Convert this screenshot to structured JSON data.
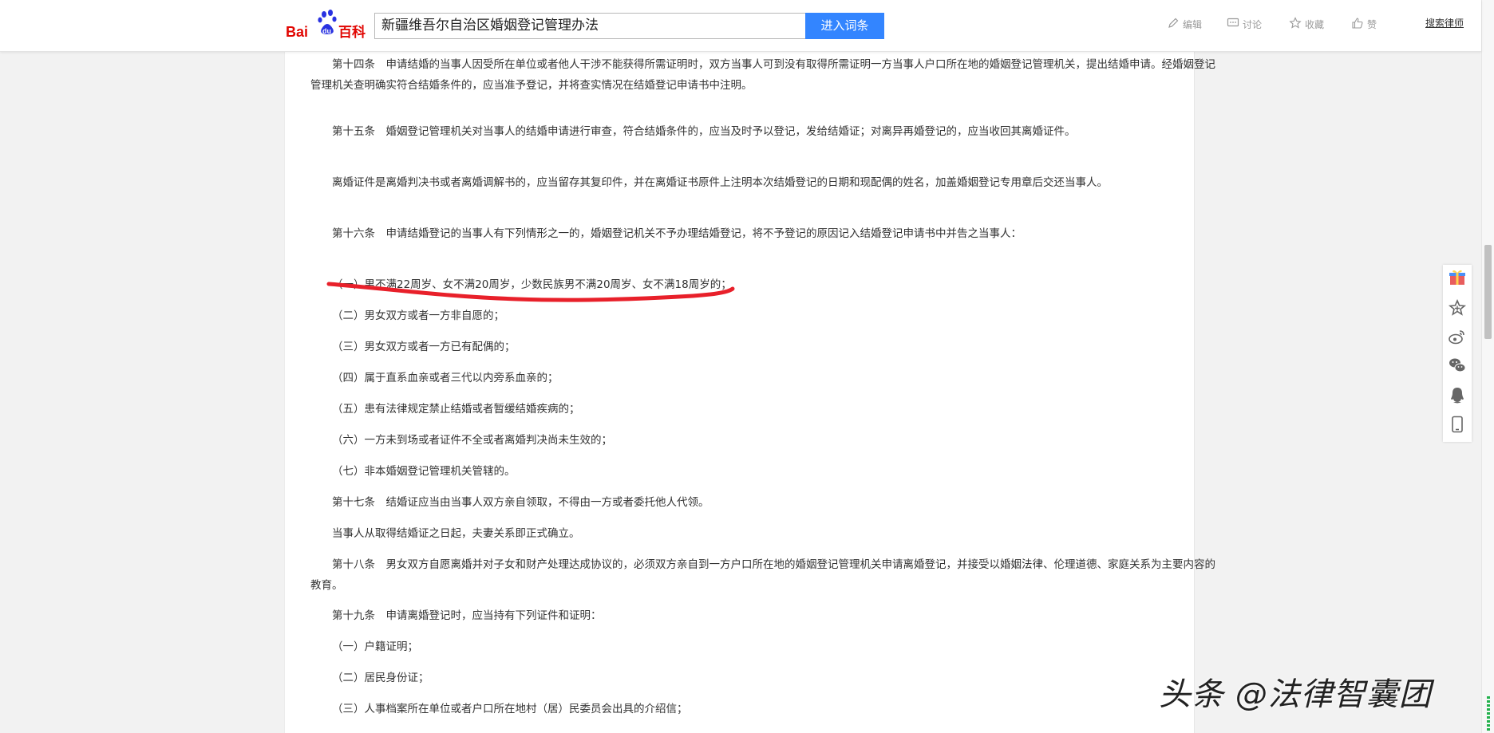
{
  "header": {
    "logo_text": "Bai百科",
    "search_value": "新疆维吾尔自治区婚姻登记管理办法",
    "search_button": "进入词条",
    "actions": {
      "edit": "编辑",
      "discuss": "讨论",
      "favorite": "收藏",
      "like": "赞"
    },
    "top_link": "搜索律师"
  },
  "article": {
    "p14": "第十四条　申请结婚的当事人因受所在单位或者他人干涉不能获得所需证明时，双方当事人可到没有取得所需证明一方当事人户口所在地的婚姻登记管理机关，提出结婚申请。经婚姻登记管理机关查明确实符合结婚条件的，应当准予登记，并将查实情况在结婚登记申请书中注明。",
    "p15": "第十五条　婚姻登记管理机关对当事人的结婚申请进行审查，符合结婚条件的，应当及时予以登记，发给结婚证；对离异再婚登记的，应当收回其离婚证件。",
    "p15b": "离婚证件是离婚判决书或者离婚调解书的，应当留存其复印件，并在离婚证书原件上注明本次结婚登记的日期和现配偶的姓名，加盖婚姻登记专用章后交还当事人。",
    "p16": "第十六条　申请结婚登记的当事人有下列情形之一的，婚姻登记机关不予办理结婚登记，将不予登记的原因记入结婚登记申请书中并告之当事人：",
    "p16_1": "（一）男不满22周岁、女不满20周岁，少数民族男不满20周岁、女不满18周岁的；",
    "p16_2": "（二）男女双方或者一方非自愿的；",
    "p16_3": "（三）男女双方或者一方已有配偶的；",
    "p16_4": "（四）属于直系血亲或者三代以内旁系血亲的；",
    "p16_5": "（五）患有法律规定禁止结婚或者暂缓结婚疾病的；",
    "p16_6": "（六）一方未到场或者证件不全或者离婚判决尚未生效的；",
    "p16_7": "（七）非本婚姻登记管理机关管辖的。",
    "p17": "第十七条　结婚证应当由当事人双方亲自领取，不得由一方或者委托他人代领。",
    "p17b": "当事人从取得结婚证之日起，夫妻关系即正式确立。",
    "p18": "第十八条　男女双方自愿离婚并对子女和财产处理达成协议的，必须双方亲自到一方户口所在地的婚姻登记管理机关申请离婚登记，并接受以婚姻法律、伦理道德、家庭关系为主要内容的教育。",
    "p19": "第十九条　申请离婚登记时，应当持有下列证件和证明：",
    "p19_1": "（一）户籍证明；",
    "p19_2": "（二）居民身份证；",
    "p19_3": "（三）人事档案所在单位或者户口所在地村（居）民委员会出具的介绍信；"
  },
  "watermark": "头条 @法律智囊团",
  "colors": {
    "accent_blue": "#3385ff",
    "highlight_red": "#e8202a"
  }
}
